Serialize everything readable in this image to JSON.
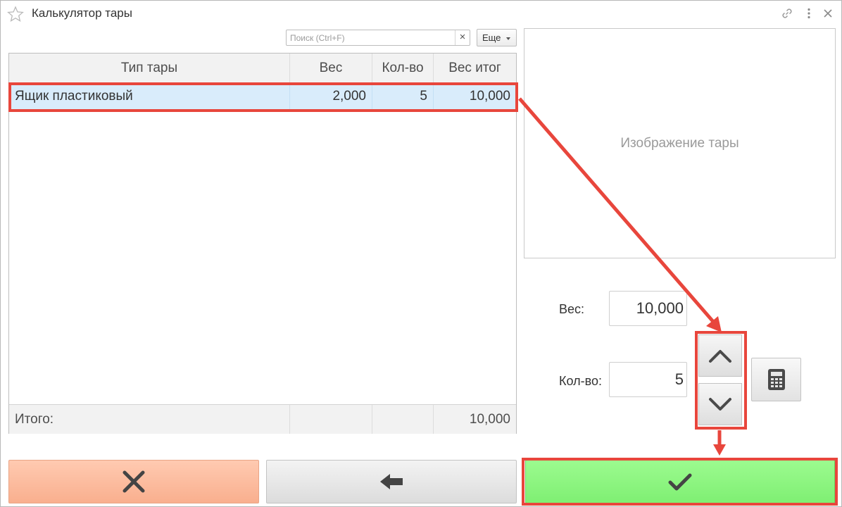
{
  "window": {
    "title": "Калькулятор тары"
  },
  "toolbar": {
    "search_placeholder": "Поиск (Ctrl+F)",
    "search_clear": "×",
    "more_label": "Еще"
  },
  "table": {
    "columns": [
      "Тип тары",
      "Вес",
      "Кол-во",
      "Вес итог"
    ],
    "rows": [
      {
        "type": "Ящик пластиковый",
        "weight": "2,000",
        "qty": "5",
        "total": "10,000"
      }
    ],
    "footer": {
      "label": "Итого:",
      "weight": "",
      "qty": "",
      "total": "10,000"
    }
  },
  "image_panel": {
    "label": "Изображение тары"
  },
  "form": {
    "weight_label": "Вес:",
    "weight_value": "10,000",
    "qty_label": "Кол-во:",
    "qty_value": "5"
  },
  "icons": {
    "favorite": "star-icon",
    "link": "link-icon",
    "menu": "more-vertical-icon",
    "close": "close-icon",
    "dropdown": "triangle-down-icon",
    "increase": "chevron-up-icon",
    "decrease": "chevron-down-icon",
    "calculator": "calculator-icon",
    "cancel": "x-icon",
    "back": "arrow-left-icon",
    "ok": "check-icon"
  },
  "colors": {
    "selection": "#d9ecfb",
    "cancel_button": "#fbb797",
    "ok_button": "#86f27a",
    "annotation": "#e8463c"
  }
}
